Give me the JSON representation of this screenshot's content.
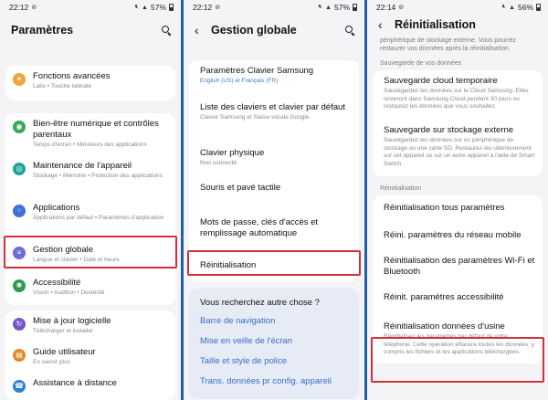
{
  "colors": {
    "divider_blue": "#1f5fae",
    "highlight_red": "#d3303a",
    "link_blue": "#3a6fc4"
  },
  "panel1": {
    "status": {
      "time": "22:12",
      "battery": "57%"
    },
    "title": "Paramètres",
    "items": [
      {
        "icon": "advanced-features-icon",
        "color": "#f2a33a",
        "glyph": "✦",
        "title": "Fonctions avancées",
        "sub": "Labs  •  Touche latérale"
      },
      {
        "icon": "digital-wellbeing-icon",
        "color": "#3aa757",
        "glyph": "◉",
        "title": "Bien-être numérique et contrôles parentaux",
        "sub": "Temps d'écran  •  Minuteurs des applications"
      },
      {
        "icon": "device-care-icon",
        "color": "#21a39a",
        "glyph": "◎",
        "title": "Maintenance de l'appareil",
        "sub": "Stockage  •  Mémoire  •  Protection des applications"
      },
      {
        "icon": "apps-icon",
        "color": "#3f6fd8",
        "glyph": "⁘",
        "title": "Applications",
        "sub": "Applications par défaut  •  Paramètres d'application"
      },
      {
        "icon": "general-management-icon",
        "color": "#6b6fd8",
        "glyph": "≡",
        "title": "Gestion globale",
        "sub": "Langue et clavier  •  Date et heure"
      },
      {
        "icon": "accessibility-icon",
        "color": "#2e9b4a",
        "glyph": "✱",
        "title": "Accessibilité",
        "sub": "Vision  •  Audition  •  Dextérité"
      },
      {
        "icon": "software-update-icon",
        "color": "#7a55c9",
        "glyph": "↻",
        "title": "Mise à jour logicielle",
        "sub": "Télécharger et installer"
      },
      {
        "icon": "user-manual-icon",
        "color": "#e6892a",
        "glyph": "▤",
        "title": "Guide utilisateur",
        "sub": "En savoir plus"
      },
      {
        "icon": "remote-support-icon",
        "color": "#2d7fd8",
        "glyph": "☎",
        "title": "Assistance à distance",
        "sub": ""
      }
    ]
  },
  "panel2": {
    "status": {
      "time": "22:12",
      "battery": "57%"
    },
    "title": "Gestion globale",
    "items": [
      {
        "title": "Paramètres Clavier Samsung",
        "sub": "English (US) et Français (FR)"
      },
      {
        "title": "Liste des claviers et clavier par défaut",
        "sub": "Clavier Samsung et Saisie vocale Google"
      },
      {
        "title": "Clavier physique",
        "sub": "Non connecté"
      },
      {
        "title": "Souris et pavé tactile",
        "sub": ""
      },
      {
        "title": "Mots de passe, clés d'accès et remplissage automatique",
        "sub": ""
      },
      {
        "title": "Réinitialisation",
        "sub": ""
      }
    ],
    "suggest_title": "Vous recherchez autre chose ?",
    "suggest_links": [
      "Barre de navigation",
      "Mise en veille de l'écran",
      "Taille et style de police",
      "Trans. données pr config. appareil"
    ]
  },
  "panel3": {
    "status": {
      "time": "22:14",
      "battery": "56%"
    },
    "title": "Réinitialisation",
    "top_text": "périphérique de stockage externe. Vous pourrez restaurer vos données après la réinitialisation.",
    "backup_label": "Sauvegarde de vos données",
    "backup_items": [
      {
        "title": "Sauvegarde cloud temporaire",
        "sub": "Sauvegardez les données sur le Cloud Samsung. Elles resteront dans Samsung Cloud pendant 30 jours ou restaurez les données que vous souhaitez."
      },
      {
        "title": "Sauvegarde sur stockage externe",
        "sub": "Sauvegardez les données sur un périphérique de stockage ou une carte SD. Restaurez-les ultérieurement sur cet appareil ou sur un autre appareil à l'aide de Smart Switch."
      }
    ],
    "reset_label": "Réinitialisation",
    "reset_items": [
      {
        "title": "Réinitialisation tous paramètres",
        "sub": ""
      },
      {
        "title": "Réini. paramètres du réseau mobile",
        "sub": ""
      },
      {
        "title": "Réinitialisation des paramètres Wi-Fi et Bluetooth",
        "sub": ""
      },
      {
        "title": "Réinit. paramètres accessibilité",
        "sub": ""
      },
      {
        "title": "Réinitialisation données d'usine",
        "sub": "Réinitialisez les paramètres par défaut de votre téléphone. Cette opération effacera toutes les données, y compris les fichiers et les applications téléchargées."
      }
    ]
  }
}
